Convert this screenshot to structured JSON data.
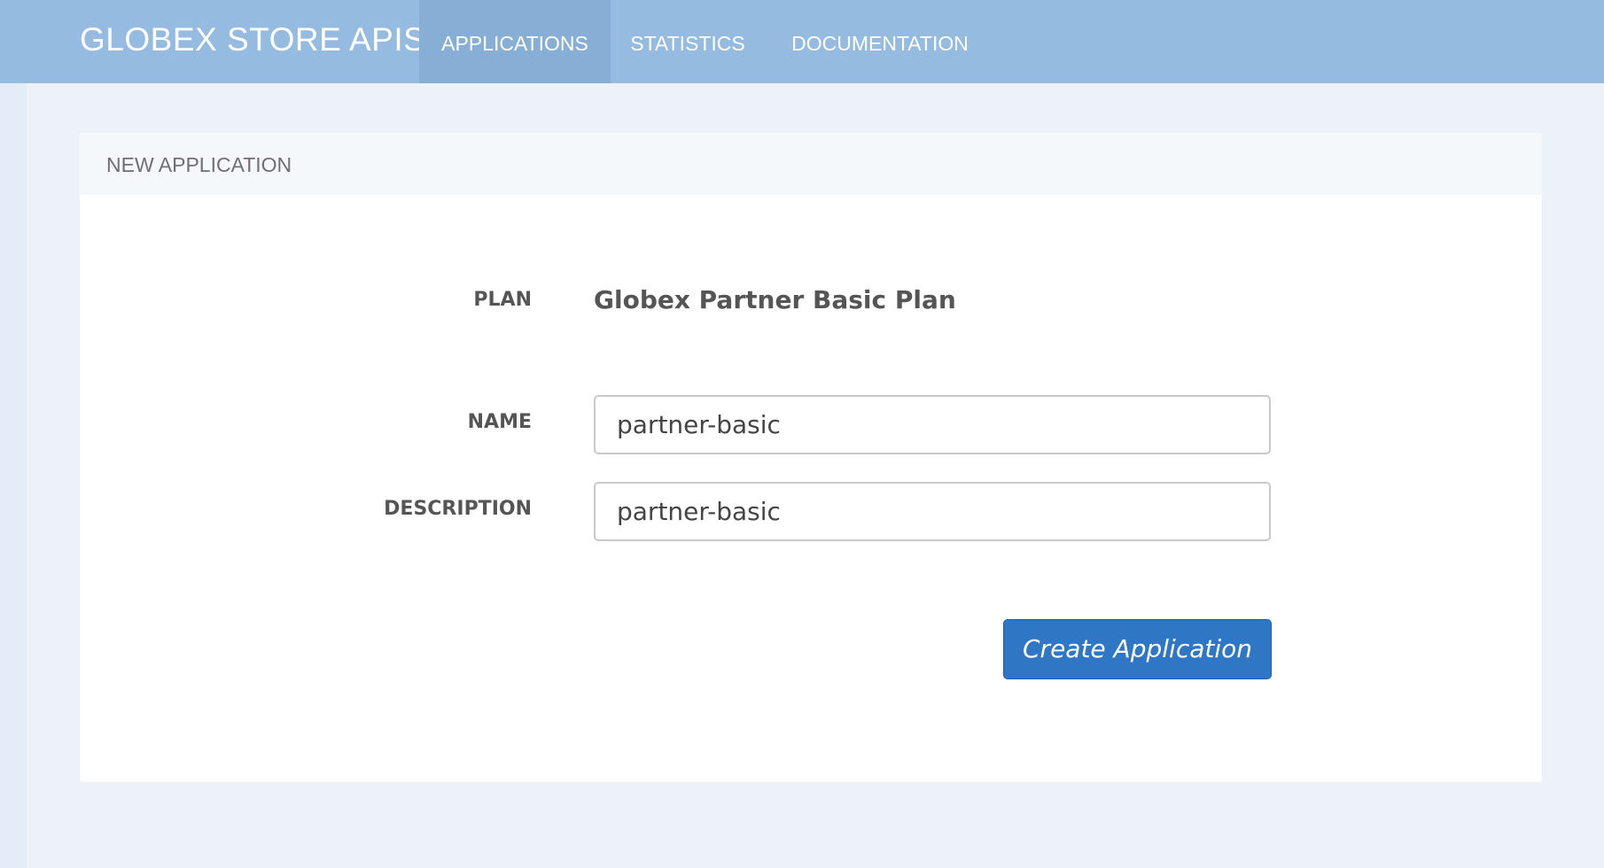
{
  "navbar": {
    "brand": "GLOBEX STORE APIS",
    "tabs": [
      {
        "label": "APPLICATIONS",
        "active": true
      },
      {
        "label": "STATISTICS",
        "active": false
      },
      {
        "label": "DOCUMENTATION",
        "active": false
      }
    ]
  },
  "panel": {
    "title": "NEW APPLICATION"
  },
  "form": {
    "plan_label": "PLAN",
    "plan_value": "Globex Partner Basic Plan",
    "name_label": "NAME",
    "name_value": "partner-basic",
    "description_label": "DESCRIPTION",
    "description_value": "partner-basic",
    "submit_label": "Create Application"
  },
  "colors": {
    "navbar": "#95bbe0",
    "active_tab": "#87afd5",
    "background": "#edf2f9",
    "primary_button": "#2f77c4"
  }
}
